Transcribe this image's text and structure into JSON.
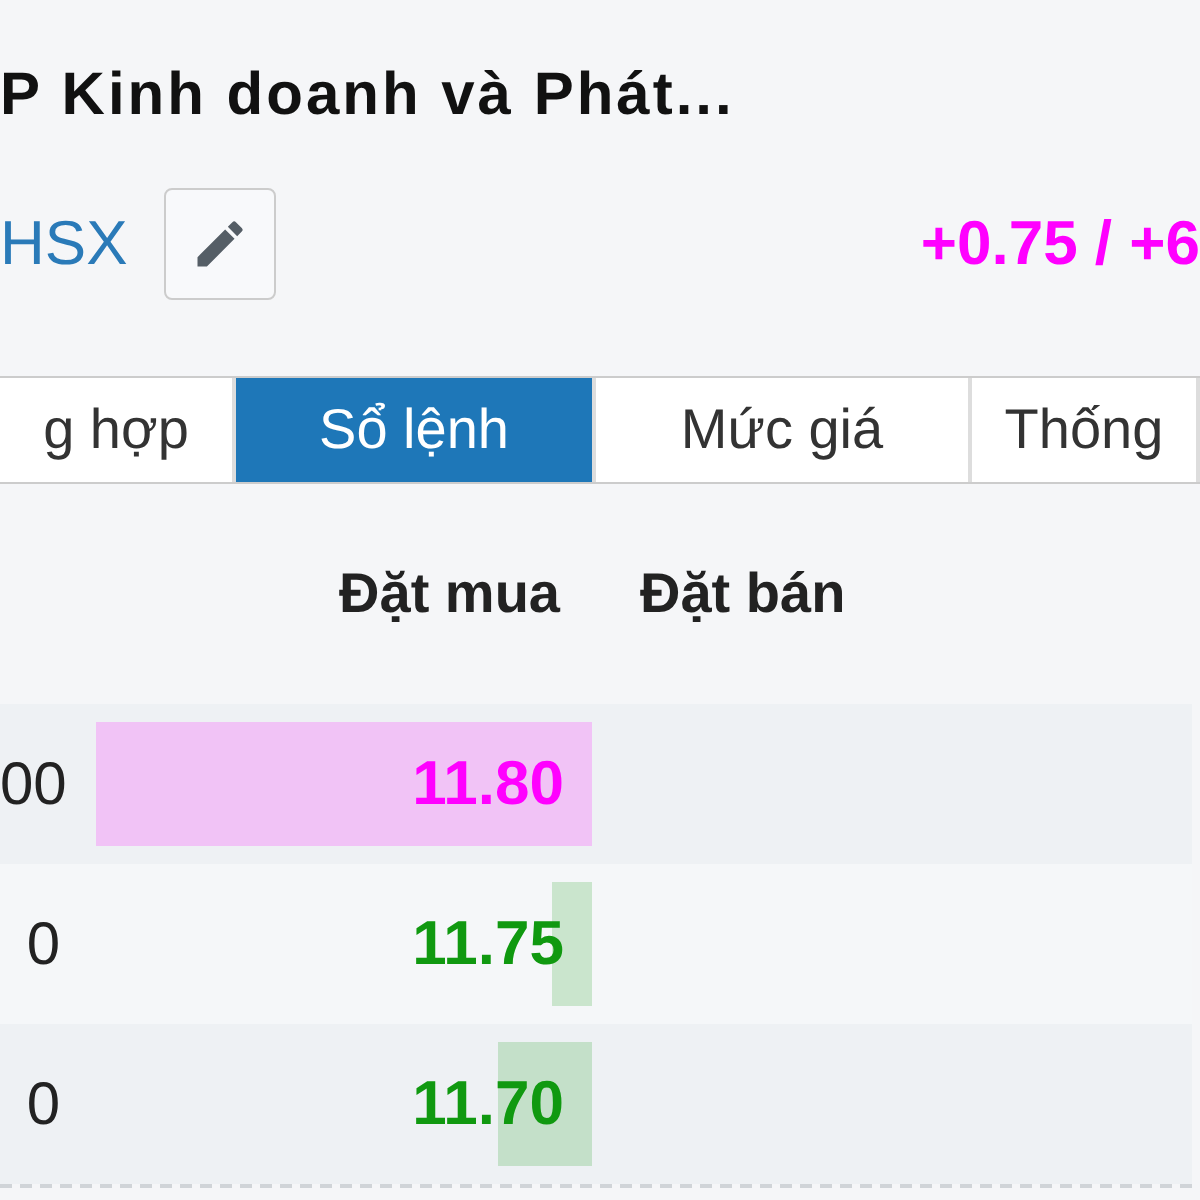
{
  "header": {
    "title": "P Kinh doanh và Phát...",
    "exchange": "HSX",
    "change": "+0.75 / +6"
  },
  "tabs": [
    {
      "label": "g hợp",
      "selected": false
    },
    {
      "label": "Sổ lệnh",
      "selected": true
    },
    {
      "label": "Mức giá",
      "selected": false
    },
    {
      "label": "Thống",
      "selected": false
    }
  ],
  "order_book": {
    "columns": [
      "Đặt mua",
      "Đặt bán"
    ],
    "rows": [
      {
        "volume": "00",
        "bid_price": "11.80",
        "color": "#ff00ff"
      },
      {
        "volume": "0",
        "bid_price": "11.75",
        "color": "#109910"
      },
      {
        "volume": "0",
        "bid_price": "11.70",
        "color": "#109910"
      }
    ]
  }
}
